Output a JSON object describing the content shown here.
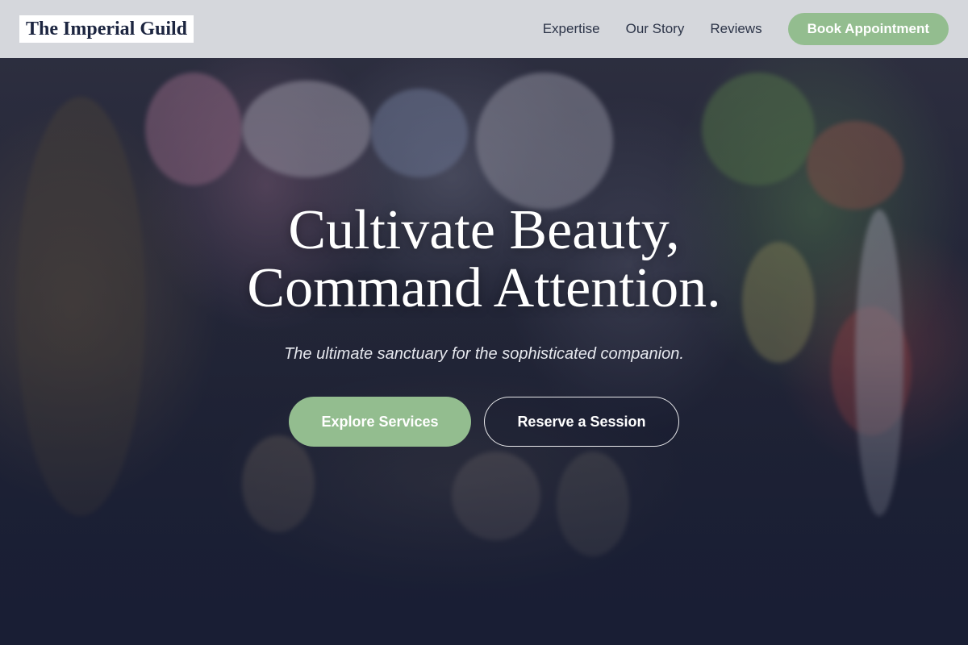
{
  "header": {
    "logo": "The Imperial Guild",
    "nav": [
      {
        "label": "Expertise"
      },
      {
        "label": "Our Story"
      },
      {
        "label": "Reviews"
      }
    ],
    "cta_label": "Book Appointment"
  },
  "hero": {
    "title_line1": "Cultivate Beauty,",
    "title_line2": "Command Attention.",
    "subtitle": "The ultimate sanctuary for the sophisticated companion.",
    "primary_button": "Explore Services",
    "secondary_button": "Reserve a Session"
  },
  "colors": {
    "accent": "#93bd8f",
    "header_bg": "#e2e4e8",
    "logo_text": "#1c2540",
    "overlay": "#181d34"
  }
}
